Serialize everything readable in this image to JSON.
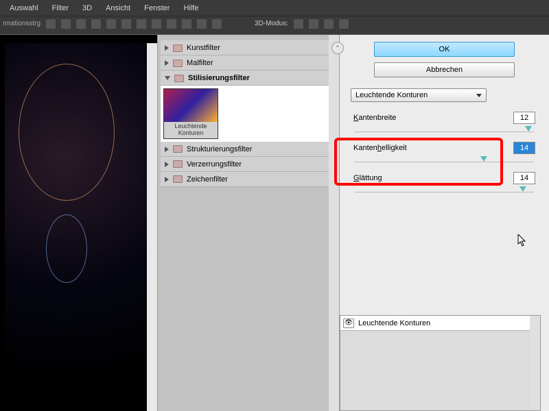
{
  "menubar": {
    "items": [
      "Auswahl",
      "Filter",
      "3D",
      "Ansicht",
      "Fenster",
      "Hilfe"
    ]
  },
  "toolbar": {
    "label3d": "3D-Modus:"
  },
  "dialog": {
    "ok": "OK",
    "cancel": "Abbrechen"
  },
  "filter_tree": {
    "items": [
      {
        "label": "Kunstfilter",
        "open": false
      },
      {
        "label": "Malfilter",
        "open": false
      },
      {
        "label": "Stilisierungsfilter",
        "open": true
      },
      {
        "label": "Strukturierungsfilter",
        "open": false
      },
      {
        "label": "Verzerrungsfilter",
        "open": false
      },
      {
        "label": "Zeichenfilter",
        "open": false
      }
    ],
    "thumb": {
      "caption": "Leuchtende Konturen"
    }
  },
  "controls": {
    "dropdown": "Leuchtende Konturen",
    "params": [
      {
        "label": "Kantenbreite",
        "value": "12",
        "range": 100,
        "handle": 95
      },
      {
        "label": "Kantenhelligkeit",
        "value": "14",
        "range": 100,
        "handle": 70,
        "selected": true
      },
      {
        "label": "Glättung",
        "value": "14",
        "range": 100,
        "handle": 92
      }
    ]
  },
  "applied": {
    "title": "Leuchtende Konturen"
  }
}
